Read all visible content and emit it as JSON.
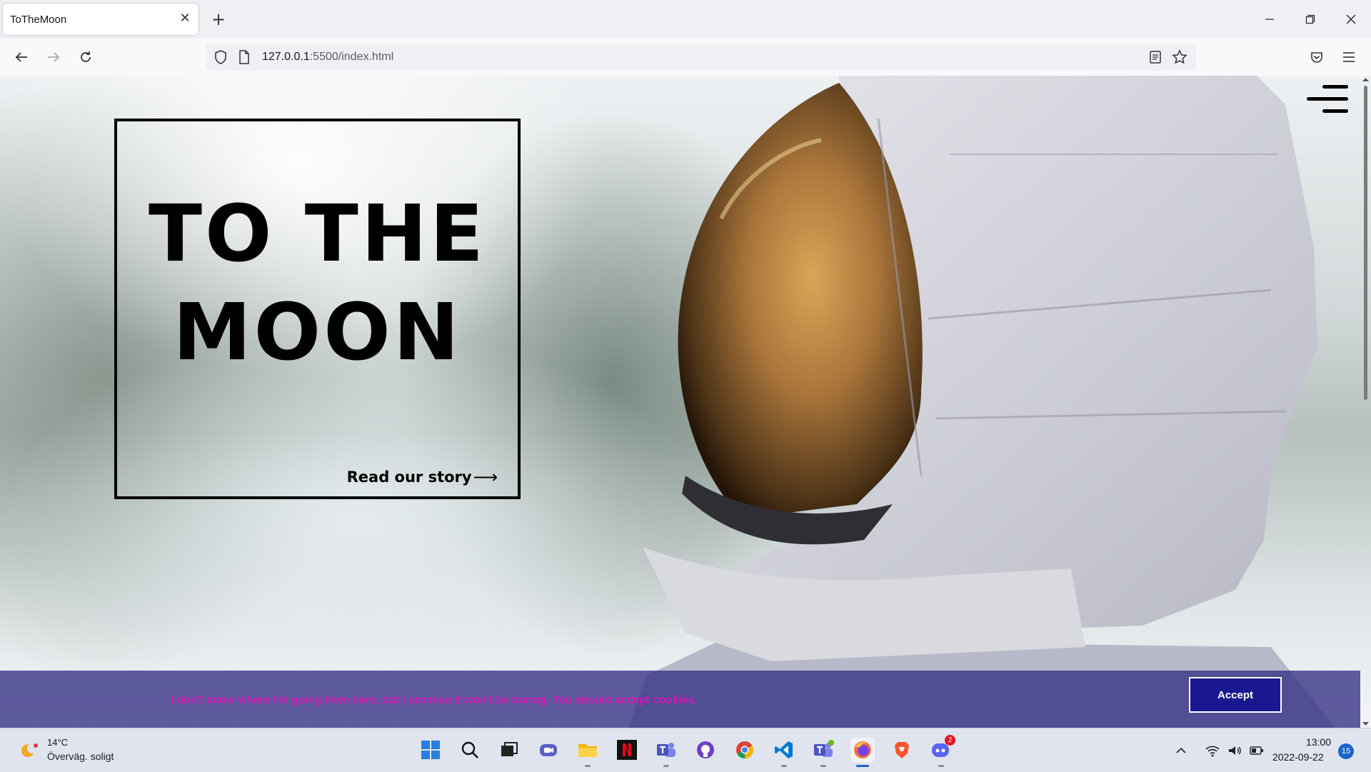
{
  "browser": {
    "tab_title": "ToTheMoon",
    "url_host": "127.0.0.1",
    "url_path": ":5500/index.html"
  },
  "page": {
    "title": "TO THE MOON",
    "story_link": "Read our story",
    "story_arrow": "⟶",
    "cookie_text": "I don't know where I'm going from here, but I promise it won't be boring. You should accept cookies.",
    "accept_label": "Accept",
    "colors": {
      "cookie_bg": "#34308488",
      "cookie_text": "#d219b4",
      "accept_bg": "#1a1890"
    }
  },
  "taskbar": {
    "weather_temp": "14°C",
    "weather_desc": "Överväg. soligt",
    "apps": [
      "start-icon",
      "search-icon",
      "task-view-icon",
      "chat-icon",
      "file-explorer-icon",
      "netflix-icon",
      "teams-icon",
      "github-icon",
      "chrome-icon",
      "vscode-icon",
      "teams-work-icon",
      "firefox-icon",
      "brave-icon",
      "discord-icon"
    ],
    "discord_badge": "2",
    "clock_time": "13:00",
    "clock_date": "2022-09-22",
    "notification_count": "15"
  }
}
